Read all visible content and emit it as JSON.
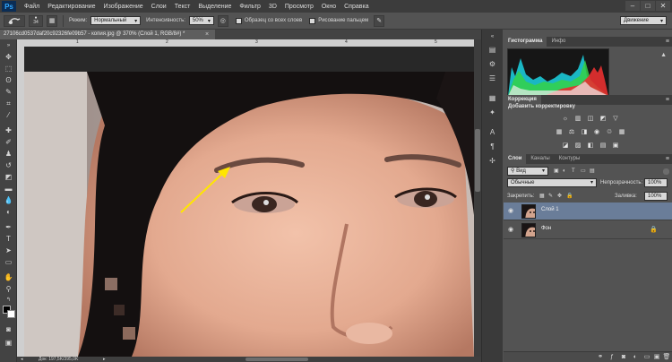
{
  "app": {
    "logo": "Ps"
  },
  "menu": [
    "Файл",
    "Редактирование",
    "Изображение",
    "Слои",
    "Текст",
    "Выделение",
    "Фильтр",
    "3D",
    "Просмотр",
    "Окно",
    "Справка"
  ],
  "options": {
    "brush_size": "34",
    "mode_label": "Режим:",
    "mode_value": "Нормальный",
    "intensity_label": "Интенсивность:",
    "intensity_value": "50%",
    "sample_all_label": "Образец со всех слоев",
    "finger_paint_label": "Рисование пальцем",
    "workspace_value": "Движение"
  },
  "document": {
    "tab_title": "27106cd0537daf20c92326fe09b57 - копия.jpg @ 370% (Слой 1, RGB/8#) *",
    "status_text": "Док: 197,5K/395,0K",
    "ruler_marks": [
      "1",
      "2",
      "3",
      "4",
      "5"
    ]
  },
  "panels": {
    "hist_tabs": [
      "Гистограмма",
      "Инфо"
    ],
    "corr_tab": "Коррекция",
    "corr_title": "Добавить корректировку",
    "layer_tabs": [
      "Слои",
      "Каналы",
      "Контуры"
    ],
    "kind_label": "Вид",
    "blend_value": "Обычные",
    "opacity_label": "Непрозрачность:",
    "opacity_value": "100%",
    "lock_label": "Закрепить:",
    "fill_label": "Заливка:",
    "fill_value": "100%",
    "layers": [
      {
        "name": "Слой 1",
        "selected": true,
        "locked": false
      },
      {
        "name": "Фон",
        "selected": false,
        "locked": true
      }
    ]
  },
  "colors": {
    "accent": "#31a8ff",
    "selected_layer": "#6a7d99",
    "arrow": "#ffe600"
  }
}
